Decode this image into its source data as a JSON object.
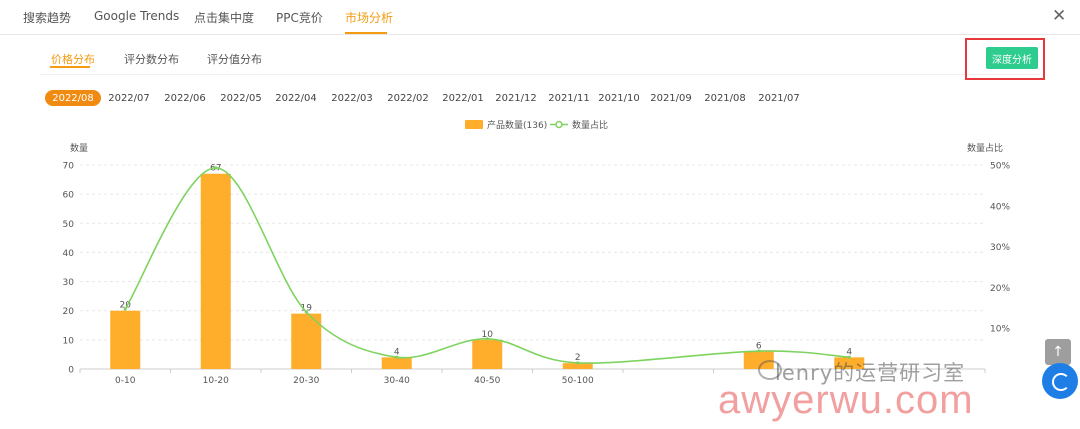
{
  "top_tabs": [
    {
      "label": "搜索趋势"
    },
    {
      "label": "Google Trends"
    },
    {
      "label": "点击集中度"
    },
    {
      "label": "PPC竞价"
    },
    {
      "label": "市场分析"
    }
  ],
  "close_glyph": "✕",
  "sub_tabs": [
    {
      "label": "价格分布"
    },
    {
      "label": "评分数分布"
    },
    {
      "label": "评分值分布"
    }
  ],
  "deep_analysis_label": "深度分析",
  "months": [
    "2022/08",
    "2022/07",
    "2022/06",
    "2022/05",
    "2022/04",
    "2022/03",
    "2022/02",
    "2022/01",
    "2021/12",
    "2021/11",
    "2021/10",
    "2021/09",
    "2021/08",
    "2021/07"
  ],
  "chart_data": {
    "type": "bar",
    "categories": [
      "0-10",
      "10-20",
      "20-30",
      "30-40",
      "40-50",
      "50-100",
      "",
      "",
      "",
      ""
    ],
    "series": [
      {
        "name": "产品数量(136)",
        "type": "bar",
        "values": [
          20,
          67,
          19,
          4,
          10,
          2,
          null,
          6,
          4,
          null
        ]
      },
      {
        "name": "数量占比",
        "type": "line",
        "values": [
          14.7,
          49.3,
          14.0,
          2.9,
          7.4,
          1.5,
          null,
          4.4,
          2.9,
          null
        ]
      }
    ],
    "ylabel": "数量",
    "y2label": "数量占比",
    "ylim": [
      0,
      70
    ],
    "y_ticks": [
      0,
      10,
      20,
      30,
      40,
      50,
      60,
      70
    ],
    "y2lim": [
      0,
      50
    ],
    "y2_ticks": [
      "",
      "10%",
      "20%",
      "30%",
      "40%",
      "50%"
    ],
    "legend_position": "top-center",
    "grid": true,
    "colors": {
      "bar": "#ffae2b",
      "line": "#7ed35f"
    }
  },
  "watermark": {
    "line1": "lenry的运营研习室",
    "line2": "awyerwu.com"
  },
  "up_glyph": "↑"
}
